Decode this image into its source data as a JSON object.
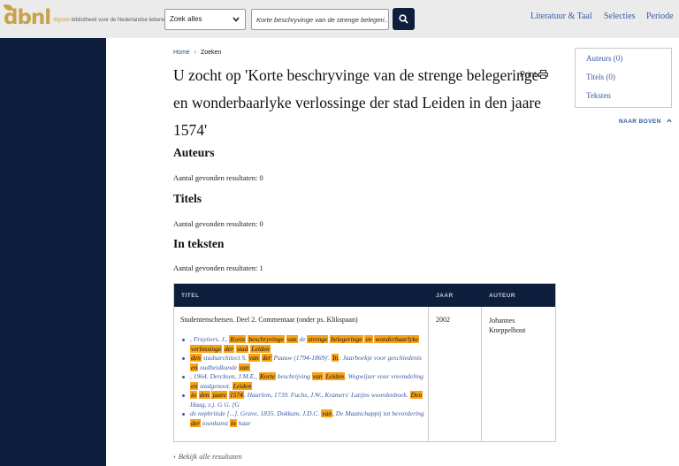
{
  "header": {
    "logo_mark": "dbnl",
    "logo_sub_prefix": "digitale",
    "logo_sub_rest": "bibliotheek voor de Nederlandse letteren",
    "scope_select": "Zoek alles",
    "search_value": "Korte beschryvinge van de strenge belegeri...",
    "nav": [
      "Literatuur & Taal",
      "Selecties",
      "Periode"
    ]
  },
  "breadcrumb": {
    "home": "Home",
    "separator": "›",
    "current": "Zoeken"
  },
  "page_title": "U zocht op 'Korte beschryvinge van de strenge belegeringe en wonderbaarlyke verlossinge der stad Leiden in den jaare 1574'",
  "print_label": "Print",
  "toc": {
    "items": [
      "Auteurs (0)",
      "Titels (0)",
      "Teksten"
    ],
    "naar_boven": "NAAR BOVEN"
  },
  "sections": {
    "auteurs": {
      "heading": "Auteurs",
      "count": "Aantal gevonden resultaten: 0"
    },
    "titels": {
      "heading": "Titels",
      "count": "Aantal gevonden resultaten: 0"
    },
    "teksten": {
      "heading": "In teksten",
      "count": "Aantal gevonden resultaten: 1"
    }
  },
  "table": {
    "headers": [
      "TITEL",
      "JAAR",
      "AUTEUR"
    ],
    "row": {
      "title": "Studentenschetsen. Deel 2. Commentaar (onder ps. Klikspaan)",
      "year": "2002",
      "author": "Johannes Kneppelhout"
    }
  },
  "all_results": "Bekijk alle resultaten",
  "colors": {
    "navy": "#0e1f3e",
    "link": "#3a5aa6",
    "highlight": "#f6a21a",
    "brand_gold": "#c8a24a"
  }
}
